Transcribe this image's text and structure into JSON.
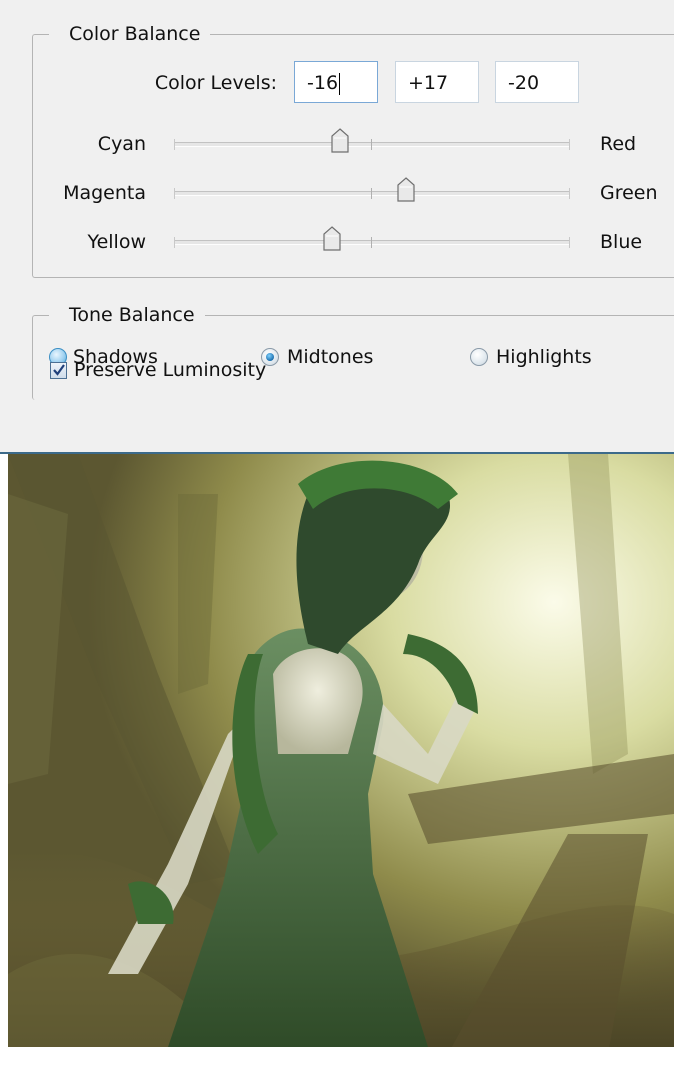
{
  "color_balance": {
    "title": "Color Balance",
    "levels_label": "Color Levels:",
    "levels": [
      "-16",
      "+17",
      "-20"
    ],
    "sliders": [
      {
        "left": "Cyan",
        "right": "Red",
        "value": -16
      },
      {
        "left": "Magenta",
        "right": "Green",
        "value": 17
      },
      {
        "left": "Yellow",
        "right": "Blue",
        "value": -20
      }
    ],
    "range": [
      -100,
      100
    ]
  },
  "tone_balance": {
    "title": "Tone Balance",
    "options": [
      "Shadows",
      "Midtones",
      "Highlights"
    ],
    "selected": "Midtones",
    "preserve_label": "Preserve Luminosity",
    "preserve_checked": true
  },
  "preview": {
    "subject": "woman in green leafy dress in sunlit forest"
  },
  "colors": {
    "accent": "#1b6fae",
    "panel_bg": "#f0f0f0",
    "divider": "#3c6a8a"
  }
}
